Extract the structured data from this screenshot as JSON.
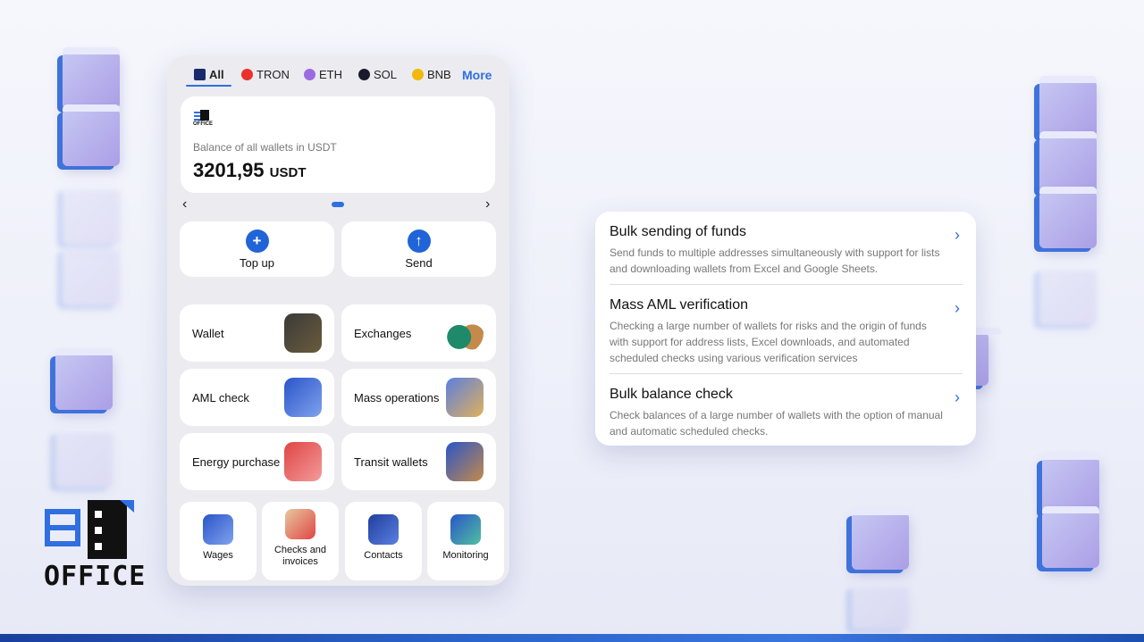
{
  "tabs": [
    {
      "label": "All",
      "color": "#1a2a6b"
    },
    {
      "label": "TRON",
      "color": "#e8322b"
    },
    {
      "label": "ETH",
      "color": "#9b6ce0"
    },
    {
      "label": "SOL",
      "color": "#1a1a2e"
    },
    {
      "label": "BNB",
      "color": "#f0b90b"
    }
  ],
  "tabs_more": "More",
  "balance": {
    "logo_text": "OFFICE",
    "label": "Balance of all wallets in USDT",
    "value": "3201,95",
    "unit": "USDT"
  },
  "pager": {
    "prev": "‹",
    "next": "›"
  },
  "actions": [
    {
      "label": "Top up",
      "icon": "plus-icon"
    },
    {
      "label": "Send",
      "icon": "arrow-up-icon"
    }
  ],
  "services": [
    {
      "label": "Wallet",
      "icon": "wallet-icon"
    },
    {
      "label": "Exchanges",
      "icon": "exchange-icon"
    },
    {
      "label": "AML check",
      "icon": "magnifier-icon"
    },
    {
      "label": "Mass operations",
      "icon": "rocket-icon"
    },
    {
      "label": "Energy purchase",
      "icon": "energy-icon"
    },
    {
      "label": "Transit wallets",
      "icon": "transit-icon"
    }
  ],
  "small_services": [
    {
      "label": "Wages",
      "icon": "envelope-icon"
    },
    {
      "label": "Checks and invoices",
      "icon": "invoice-icon"
    },
    {
      "label": "Contacts",
      "icon": "contacts-book-icon"
    },
    {
      "label": "Monitoring",
      "icon": "monitor-icon"
    }
  ],
  "features": [
    {
      "title": "Bulk sending of funds",
      "description": "Send funds to multiple addresses simultaneously with support for lists and downloading wallets from Excel and Google Sheets."
    },
    {
      "title": "Mass AML verification",
      "description": "Checking a large number of wallets for risks and the origin of funds with support for address lists, Excel downloads, and automated scheduled checks using various verification services"
    },
    {
      "title": "Bulk balance check",
      "description": "Check balances of a large number of wallets with the option of manual and automatic scheduled checks."
    }
  ],
  "brand": {
    "name": "OFFICE"
  },
  "colors": {
    "accent": "#2f6fe0",
    "action_button": "#2164d8",
    "cube_face": "#b7b3ee",
    "cube_side": "#3f72db"
  }
}
